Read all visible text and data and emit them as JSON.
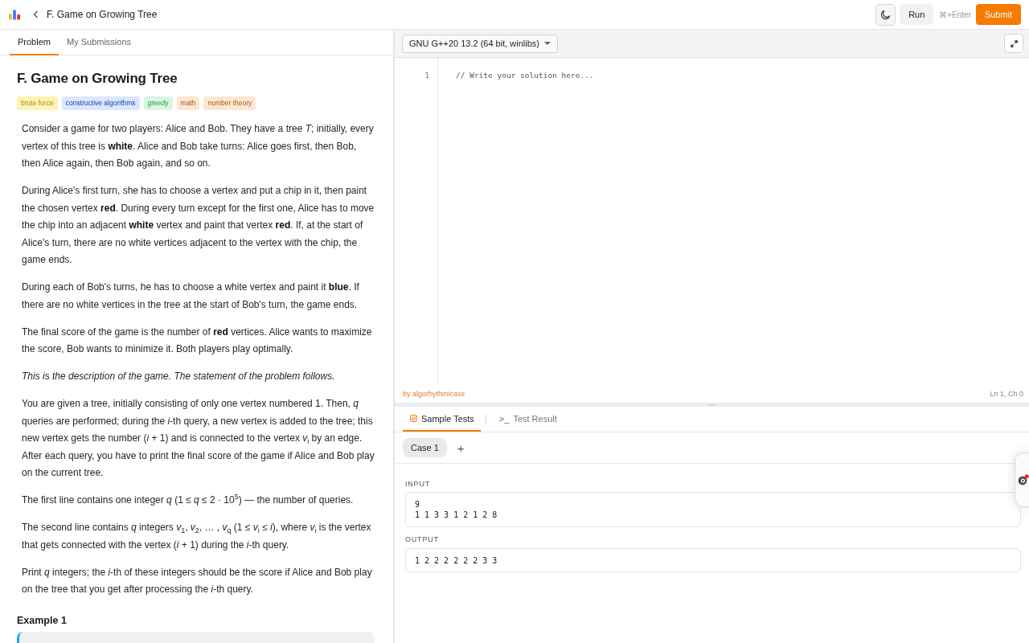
{
  "header": {
    "title": "F. Game on Growing Tree",
    "run_label": "Run",
    "shortcut": "⌘+Enter",
    "submit_label": "Submit"
  },
  "problem_tabs": [
    {
      "label": "Problem",
      "selected": true
    },
    {
      "label": "My Submissions",
      "selected": false
    }
  ],
  "problem": {
    "title": "F. Game on Growing Tree",
    "tags": [
      {
        "label": "brute force",
        "color": "#fdf3b4"
      },
      {
        "label": "constructive algorithms",
        "color": "#dbe7fd"
      },
      {
        "label": "greedy",
        "color": "#dcf5e3"
      },
      {
        "label": "math",
        "color": "#fde7d3"
      },
      {
        "label": "number theory",
        "color": "#fde7d3"
      }
    ],
    "statement": [
      {
        "kind": "text",
        "text": "Consider a game for two players: Alice and Bob. They have a tree *T*; initially, every vertex of this tree is **white**. Alice and Bob take turns: Alice goes first, then Bob, then Alice again, then Bob again, and so on."
      },
      {
        "kind": "text",
        "text": "During Alice's first turn, she has to choose a vertex and put a chip in it, then paint the chosen vertex **red**. During every turn except for the first one, Alice has to move the chip into an adjacent **white** vertex and paint that vertex **red**. If, at the start of Alice's turn, there are no white vertices adjacent to the vertex with the chip, the game ends."
      },
      {
        "kind": "text",
        "text": "During each of Bob's turns, he has to choose a white vertex and paint it **blue**. If there are no white vertices in the tree at the start of Bob's turn, the game ends."
      },
      {
        "kind": "text",
        "text": "The final score of the game is the number of **red** vertices. Alice wants to maximize the score, Bob wants to minimize it. Both players play optimally."
      },
      {
        "kind": "note",
        "text": "This is the description of the game. The statement of the problem follows."
      },
      {
        "kind": "text",
        "text": "You are given a tree, initially consisting of only one vertex numbered 1. Then, *q* queries are performed; during the *i*-th query, a new vertex is added to the tree; this new vertex gets the number (*i* + 1) and is connected to the vertex *v*$_{i}$ by an edge. After each query, you have to print the final score of the game if Alice and Bob play on the current tree."
      },
      {
        "kind": "text",
        "text": "The first line contains one integer *q* (1 ≤ *q* ≤ 2 · 10$^{5}$) — the number of queries."
      },
      {
        "kind": "text",
        "text": "The second line contains *q* integers *v*$_{1}$, *v*$_{2}$, … , *v*$_{q}$ (1 ≤ *v*$_{i}$ ≤ *i*), where *v*$_{i}$ is the vertex that gets connected with the vertex (*i* + 1) during the *i*-th query."
      },
      {
        "kind": "text",
        "text": "Print *q* integers; the *i*-th of these integers should be the score if Alice and Bob play on the tree that you get after processing the *i*-th query."
      }
    ],
    "example_heading": "Example 1"
  },
  "editor": {
    "language": "GNU G++20 13.2 (64 bit, winlibs)",
    "lines": [
      {
        "number": "1",
        "code": "// Write your solution here..."
      }
    ],
    "author": "by algorhythmicass",
    "cursor": "Ln 1, Ch 0"
  },
  "test_tabs": [
    {
      "kind": "checklist",
      "label": "Sample Tests",
      "selected": true
    },
    {
      "kind": "terminal",
      "prefix": ">_",
      "label": "Test Result",
      "selected": false
    }
  ],
  "cases": [
    {
      "label": "Case 1",
      "selected": true
    }
  ],
  "add_case": "+",
  "input": {
    "label": "INPUT",
    "value": "9\n1 1 3 3 1 2 1 2 8"
  },
  "output": {
    "label": "OUTPUT",
    "value": "1 2 2 2 2 2 2 3 3"
  }
}
